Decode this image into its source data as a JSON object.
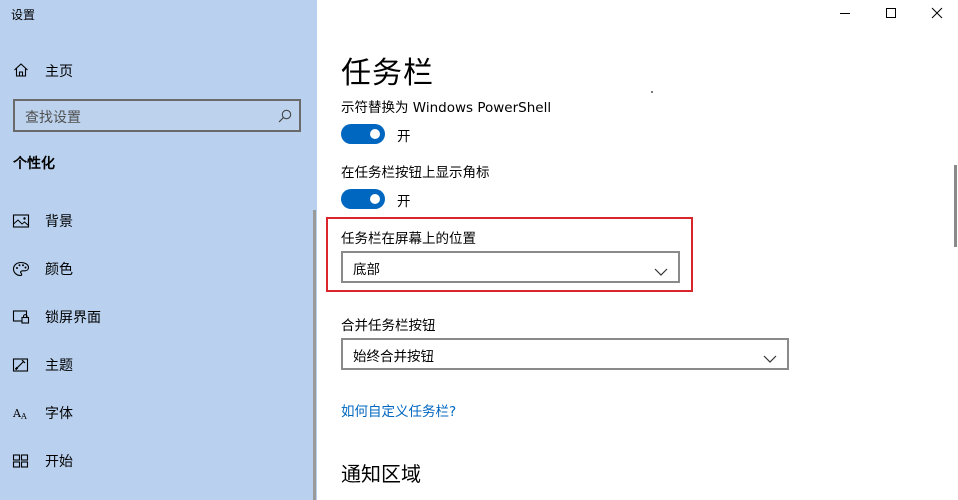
{
  "app": {
    "title": "设置"
  },
  "sidebar": {
    "home_label": "主页",
    "search_placeholder": "查找设置",
    "section_head": "个性化",
    "items": [
      {
        "label": "背景",
        "icon": "image-icon"
      },
      {
        "label": "颜色",
        "icon": "palette-icon"
      },
      {
        "label": "锁屏界面",
        "icon": "lock-screen-icon"
      },
      {
        "label": "主题",
        "icon": "theme-icon"
      },
      {
        "label": "字体",
        "icon": "font-icon"
      },
      {
        "label": "开始",
        "icon": "start-icon"
      }
    ]
  },
  "main": {
    "page_title": "任务栏",
    "powershell": {
      "label": "示符替换为 Windows PowerShell",
      "state": "开",
      "on": true
    },
    "badges": {
      "label": "在任务栏按钮上显示角标",
      "state": "开",
      "on": true
    },
    "position": {
      "label": "任务栏在屏幕上的位置",
      "value": "底部"
    },
    "combine": {
      "label": "合并任务栏按钮",
      "value": "始终合并按钮"
    },
    "help_link": "如何自定义任务栏?",
    "section_title": "通知区域"
  },
  "colors": {
    "accent": "#0067c0",
    "sidebar_bg": "#b9d1ef",
    "highlight": "#d9262d"
  }
}
